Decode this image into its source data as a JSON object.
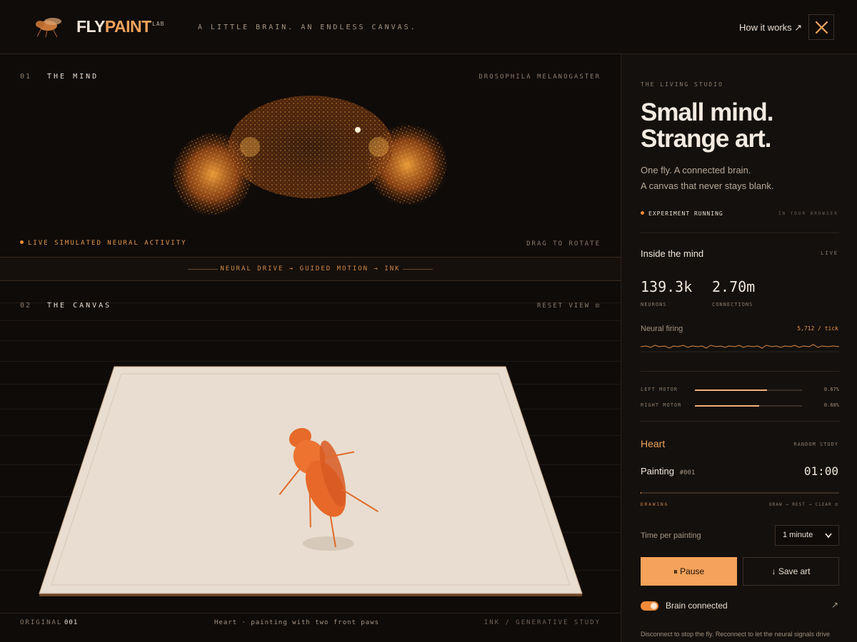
{
  "header": {
    "brand_fly": "FLY",
    "brand_paint": "PAINT",
    "brand_sup": "LAB",
    "tagline": "A LITTLE BRAIN. AN ENDLESS CANVAS.",
    "how_it_works": "How it works ↗",
    "x_icon": "x-logo-icon"
  },
  "mind": {
    "number": "01",
    "title": "THE MIND",
    "species": "DROSOPHILA MELANOGASTER",
    "live": "LIVE SIMULATED NEURAL ACTIVITY",
    "drag": "DRAG TO ROTATE"
  },
  "band": {
    "text": "NEURAL DRIVE → GUIDED MOTION → INK"
  },
  "canvas": {
    "number": "02",
    "title": "THE CANVAS",
    "reset": "RESET VIEW ⊡",
    "original_label": "ORIGINAL",
    "original_num": "001",
    "caption": "Heart · painting with two front paws",
    "footer_right": "INK / GENERATIVE STUDY"
  },
  "studio": {
    "label": "THE LIVING STUDIO",
    "hero_line1": "Small mind.",
    "hero_line2": "Strange art.",
    "sub1": "One fly. A connected brain.",
    "sub2": "A canvas that never stays blank.",
    "status": "EXPERIMENT RUNNING",
    "status_right": "IN YOUR BROWSER"
  },
  "inside": {
    "title": "Inside the mind",
    "live": "LIVE",
    "neurons_value": "139.3k",
    "neurons_label": "NEURONS",
    "connections_value": "2.70m",
    "connections_label": "CONNECTIONS",
    "firing_label": "Neural firing",
    "firing_value": "5,712 / tick"
  },
  "motors": [
    {
      "label": "LEFT MOTOR",
      "value": "0.67%",
      "fill": 0.67
    },
    {
      "label": "RIGHT MOTOR",
      "value": "0.60%",
      "fill": 0.6
    }
  ],
  "painting": {
    "name": "Heart",
    "study": "RANDOM STUDY",
    "label": "Painting",
    "num": "#001",
    "time": "01:00",
    "progress": 0.0,
    "phase": "DRAWING",
    "steps": "DRAW → REST → CLEAR ⊡",
    "time_label": "Time per painting",
    "time_option": "1 minute",
    "pause": "⏸ Pause",
    "save": "↓ Save art",
    "brain": "Brain connected",
    "note": "Disconnect to stop the fly. Reconnect to let the neural signals drive"
  },
  "colors": {
    "accent": "#f5a25a",
    "orange": "#f08a3a",
    "bg": "#0f0b09",
    "paper": "#e8ddd0"
  }
}
